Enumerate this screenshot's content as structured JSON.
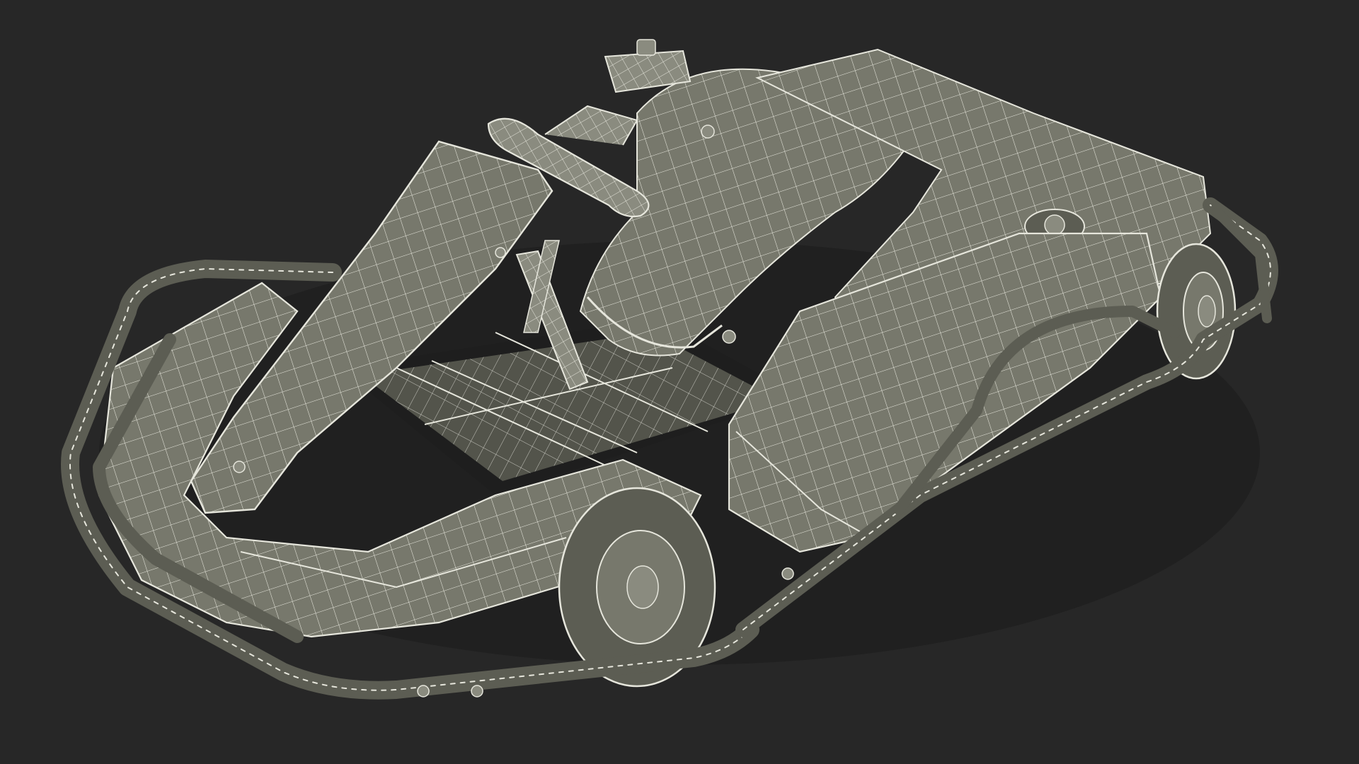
{
  "render": {
    "background_color": "#272727",
    "surface_color": "#77786c",
    "surface_shade_color": "#5c5d53",
    "surface_light_color": "#8a8b7f",
    "wire_color": "#e6e6dc",
    "dark_gap_color": "#1e1e1e",
    "subject": "go-kart-wireframe-model",
    "view": "isometric-front-left"
  }
}
